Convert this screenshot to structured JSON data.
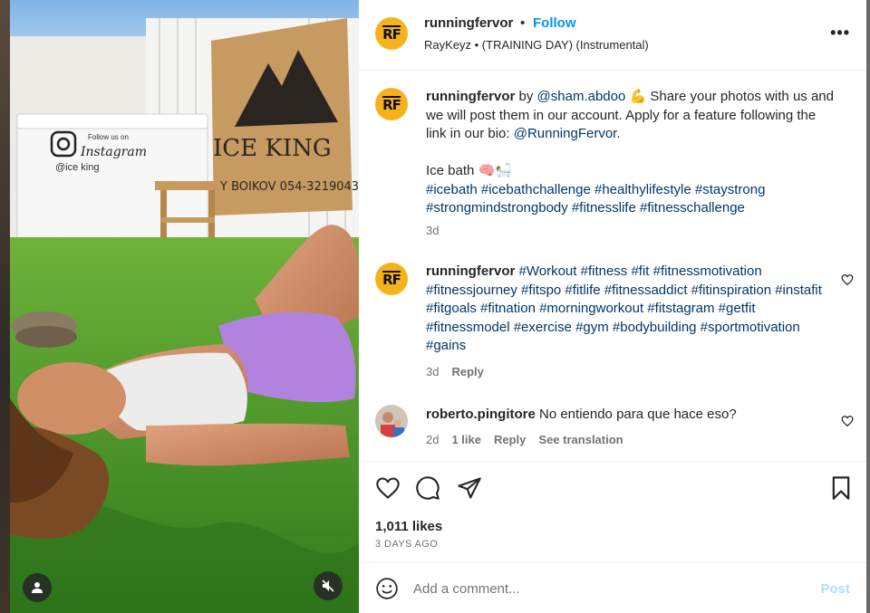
{
  "media": {
    "sign_text": "ICE KING",
    "sign_sub": "Y BOIKOV  054-3219043",
    "freezer_follow": "Follow us on",
    "freezer_instagram": "Instagram",
    "freezer_handle": "@ice king"
  },
  "header": {
    "avatar_initials": "RF",
    "username": "runningfervor",
    "separator": "•",
    "follow_label": "Follow",
    "audio": "RayKeyz • (TRAINING DAY) (Instrumental)",
    "more_label": "•••"
  },
  "caption": {
    "avatar_initials": "RF",
    "username": "runningfervor",
    "by": " by ",
    "mention": "@sham.abdoo",
    "emoji1": "💪",
    "text1": " Share your photos with us and we will post them in our account. Apply for a feature following the link in our bio: ",
    "bio_link": "@RunningFervor",
    "period": ".",
    "line2": "Ice bath 🧠🛀",
    "hashtags": "#icebath #icebathchallenge #healthylifestyle #staystrong #strongmindstrongbody #fitnesslife #fitnesschallenge",
    "time": "3d"
  },
  "comment1": {
    "avatar_initials": "RF",
    "username": "runningfervor",
    "hashtags": "#Workout #fitness #fit #fitnessmotivation #fitnessjourney #fitspo #fitlife #fitnessaddict #fitinspiration #instafit #fitgoals #fitnation #morningworkout #fitstagram #getfit #fitnessmodel #exercise #gym #bodybuilding #sportmotivation #gains",
    "time": "3d",
    "reply": "Reply"
  },
  "comment2": {
    "username": "roberto.pingitore",
    "text": "No entiendo para que hace eso?",
    "time": "2d",
    "likes": "1 like",
    "reply": "Reply",
    "translate": "See translation"
  },
  "actions": {
    "likes": "1,011 likes",
    "date": "3 DAYS AGO"
  },
  "add_comment": {
    "placeholder": "Add a comment...",
    "post_label": "Post"
  },
  "colors": {
    "link": "#00376b",
    "follow": "#0095f6",
    "post_disabled": "#b3dbff",
    "brand_avatar": "#f5b21d"
  }
}
